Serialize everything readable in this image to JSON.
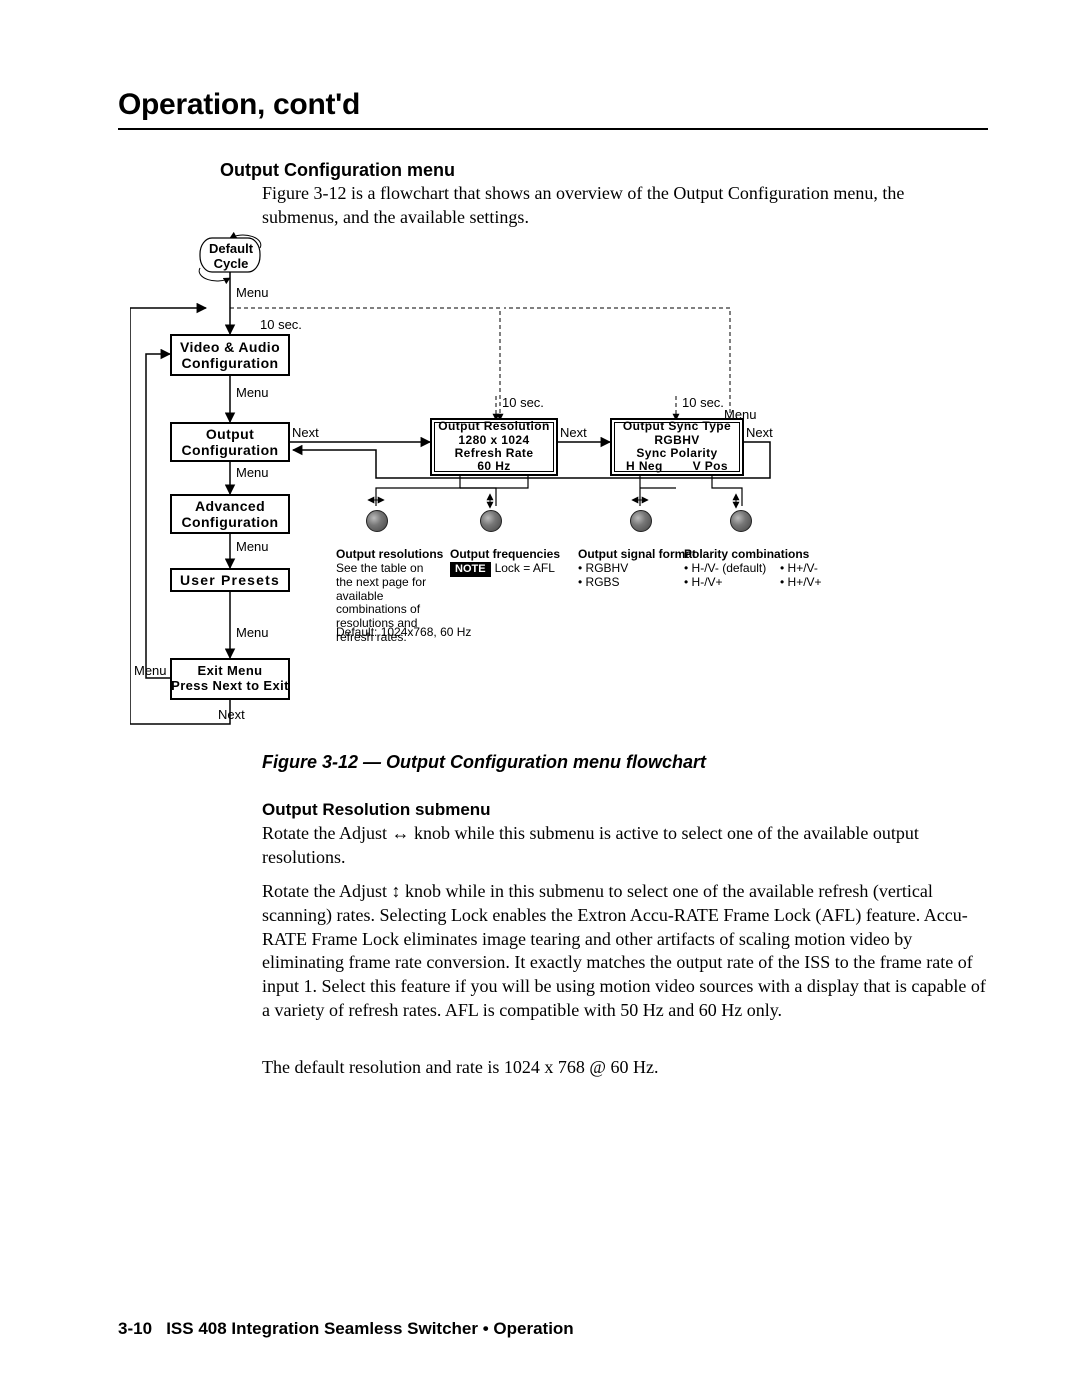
{
  "header": {
    "title": "Operation, cont'd"
  },
  "section": {
    "title": "Output Configuration menu",
    "intro": "Figure 3-12 is a flowchart that shows an overview of the Output Configuration menu, the submenus, and the available settings."
  },
  "flow": {
    "default_cycle": "Default\nCycle",
    "menu_label": "Menu",
    "next_label": "Next",
    "ten_sec": "10 sec.",
    "nodes": {
      "va": "Video & Audio\nConfiguration",
      "oc": "Output\nConfiguration",
      "ac": "Advanced\nConfiguration",
      "up": "User Presets",
      "exit": "Exit Menu\nPress Next to Exit",
      "ores": "Output Resolution\n1280 x 1024\nRefresh Rate\n60 Hz",
      "osync": "Output Sync Type\nRGBHV\nSync Polarity\nH Neg        V Pos"
    },
    "cols": {
      "out_res": {
        "head": "Output resolutions",
        "text": "See the table on the next page for available combinations of resolutions and refresh rates.",
        "default": "Default:  1024x768, 60 Hz"
      },
      "out_freq": {
        "head": "Output frequencies",
        "note_label": "NOTE",
        "note_text": "Lock = AFL"
      },
      "out_sig": {
        "head": "Output signal format",
        "items": [
          "RGBHV",
          "RGBS"
        ]
      },
      "pol": {
        "head": "Polarity combinations",
        "left": [
          "H-/V-  (default)",
          "H-/V+"
        ],
        "right": [
          "H+/V-",
          "H+/V+"
        ]
      }
    }
  },
  "figure_caption": "Figure 3-12 — Output Configuration menu flowchart",
  "subsection": {
    "title": "Output Resolution submenu",
    "p1a": "Rotate the Adjust ",
    "p1b": " knob while this submenu is active to select one of the available output resolutions.",
    "p2a": "Rotate the Adjust ",
    "p2b": " knob while in this submenu to select one of the available refresh (vertical scanning) rates.  Selecting Lock enables the Extron Accu-RATE Frame Lock (AFL) feature.  Accu-RATE Frame Lock eliminates image tearing and other artifacts of scaling motion video by eliminating frame rate conversion.  It exactly matches the output rate of the ISS to the frame rate of input 1.  Select this feature if you will be using motion video sources with a display that is capable of a variety of refresh rates.  AFL is compatible with 50 Hz and 60 Hz only.",
    "p3": "The default resolution and rate is 1024 x 768 @ 60 Hz."
  },
  "footer": {
    "pageno": "3-10",
    "text": "ISS 408 Integration Seamless Switcher • Operation"
  }
}
